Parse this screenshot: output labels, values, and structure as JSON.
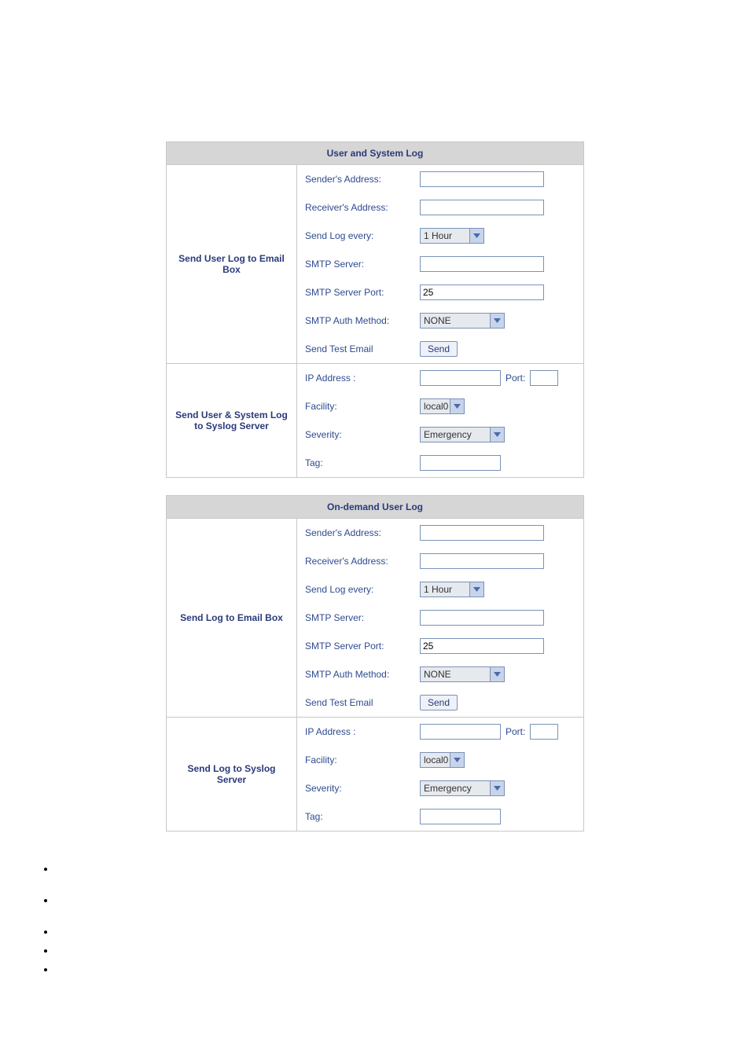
{
  "sections": {
    "user_system_log": {
      "title": "User and System Log",
      "email_block": {
        "group_title": "Send User Log to Email Box",
        "sender_label": "Sender's Address:",
        "sender_value": "",
        "receiver_label": "Receiver's Address:",
        "receiver_value": "",
        "interval_label": "Send Log every:",
        "interval_value": "1 Hour",
        "smtp_server_label": "SMTP Server:",
        "smtp_server_value": "",
        "smtp_port_label": "SMTP Server Port:",
        "smtp_port_value": "25",
        "smtp_auth_label": "SMTP Auth Method:",
        "smtp_auth_value": "NONE",
        "test_label": "Send Test Email",
        "test_button": "Send"
      },
      "syslog_block": {
        "group_title": "Send User & System Log to Syslog Server",
        "ip_label": "IP Address :",
        "ip_value": "",
        "port_label": "Port:",
        "port_value": "",
        "facility_label": "Facility:",
        "facility_value": "local0",
        "severity_label": "Severity:",
        "severity_value": "Emergency",
        "tag_label": "Tag:",
        "tag_value": ""
      }
    },
    "ondemand": {
      "title": "On-demand User Log",
      "email_block": {
        "group_title": "Send Log to Email Box",
        "sender_label": "Sender's Address:",
        "sender_value": "",
        "receiver_label": "Receiver's Address:",
        "receiver_value": "",
        "interval_label": "Send Log every:",
        "interval_value": "1 Hour",
        "smtp_server_label": "SMTP Server:",
        "smtp_server_value": "",
        "smtp_port_label": "SMTP Server Port:",
        "smtp_port_value": "25",
        "smtp_auth_label": "SMTP Auth Method:",
        "smtp_auth_value": "NONE",
        "test_label": "Send Test Email",
        "test_button": "Send"
      },
      "syslog_block": {
        "group_title": "Send Log to Syslog Server",
        "ip_label": "IP Address :",
        "ip_value": "",
        "port_label": "Port:",
        "port_value": "",
        "facility_label": "Facility:",
        "facility_value": "local0",
        "severity_label": "Severity:",
        "severity_value": "Emergency",
        "tag_label": "Tag:",
        "tag_value": ""
      }
    }
  }
}
